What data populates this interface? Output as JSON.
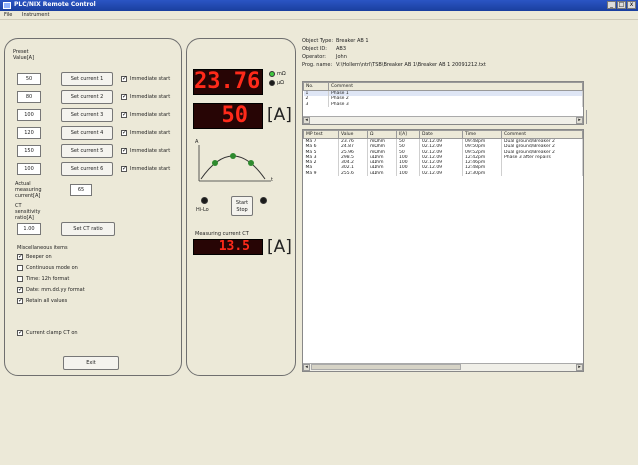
{
  "window": {
    "title": "PLC/NIX Remote Control",
    "controls": [
      "_",
      "□",
      "x"
    ]
  },
  "menu": [
    "File",
    "Instrument"
  ],
  "left_panel": {
    "preset_label": "Preset Value[A]",
    "presets": [
      {
        "value": "50",
        "button": "Set current 1",
        "check_label": "Immediate start"
      },
      {
        "value": "80",
        "button": "Set current 2",
        "check_label": "Immediate start"
      },
      {
        "value": "100",
        "button": "Set current 3",
        "check_label": "Immediate start"
      },
      {
        "value": "120",
        "button": "Set current 4",
        "check_label": "Immediate start"
      },
      {
        "value": "150",
        "button": "Set current 5",
        "check_label": "Immediate start"
      },
      {
        "value": "100",
        "button": "Set current 6",
        "check_label": "Immediate start"
      }
    ],
    "actual_label": "Actual measuring current[A]",
    "actual_value": "65",
    "ct_label": "CT sensitivity ratio[A]",
    "ct_value": "1.00",
    "ct_button": "Set CT ratio",
    "misc_title": "Miscellaneous items",
    "misc_items": [
      {
        "label": "Beeper on",
        "checked": true
      },
      {
        "label": "Continuous mode on",
        "checked": false
      },
      {
        "label": "Time: 12h format",
        "checked": false
      },
      {
        "label": "Date: mm.dd.yy format",
        "checked": true
      },
      {
        "label": "Retain all values",
        "checked": true
      }
    ],
    "clamp_label": "Current clamp CT on",
    "clamp_checked": true,
    "exit_button": "Exit"
  },
  "mid_panel": {
    "display1": "23.76",
    "status1": "mΩ",
    "status2": "μΩ",
    "display2": "50",
    "unit": "[A]",
    "curve_y_label": "A",
    "curve_x_label": "t",
    "left_led_label": "Hi-Lo",
    "start_stop_button": "Start Stop",
    "measuring_ct_label": "Measuring current CT",
    "display3": "13.5",
    "display3_unit": "[A]"
  },
  "info": [
    {
      "label": "Object Type:",
      "value": "Breaker AB 1"
    },
    {
      "label": "Object ID:",
      "value": "AB3"
    },
    {
      "label": "Operator:",
      "value": "John"
    },
    {
      "label": "Prog. name:",
      "value": "V:\\Hollern\\ntrl\\TSB\\Breaker AB 1\\Breaker AB 1 20091212.txt"
    }
  ],
  "phase_table": {
    "headers": [
      "No.",
      "Comment"
    ],
    "rows": [
      [
        "1",
        "Phase 1"
      ],
      [
        "2",
        "Phase 2"
      ],
      [
        "3",
        "Phase 3"
      ]
    ]
  },
  "results_table": {
    "headers": [
      "MP test",
      "Value",
      "Ω",
      "I[A]",
      "Date",
      "Time",
      "Comment"
    ],
    "rows": [
      [
        "Ma 7",
        "23.76",
        "mΩhm",
        "50",
        "02.12.09",
        "09:48pm",
        "Dual ground/Breaker 2"
      ],
      [
        "Ma 6",
        "24.87",
        "mΩhm",
        "50",
        "02.12.09",
        "09:50pm",
        "Dual ground/Breaker 2"
      ],
      [
        "Ma 5",
        "25.96",
        "mΩhm",
        "50",
        "02.12.09",
        "09:52pm",
        "Dual ground/Breaker 2"
      ],
      [
        "Ma 3",
        "298.5",
        "uΩhm",
        "100",
        "02.12.09",
        "12:42pm",
        "Phase 3 after repairs"
      ],
      [
        "Ma 2",
        "304.2",
        "uΩhm",
        "100",
        "02.12.09",
        "12:46pm",
        ""
      ],
      [
        "Ma",
        "302.1",
        "uΩhm",
        "100",
        "02.12.09",
        "12:48pm",
        ""
      ],
      [
        "Ma 9",
        "255.6",
        "uΩhm",
        "100",
        "02.12.09",
        "12:30pm",
        ""
      ]
    ]
  },
  "colors": {
    "titlebar": "#2b55c4",
    "led_bg": "#270505",
    "led_text": "#ff2a1a",
    "status_green": "#3fc73f",
    "curve_green": "#2e8a2e"
  }
}
